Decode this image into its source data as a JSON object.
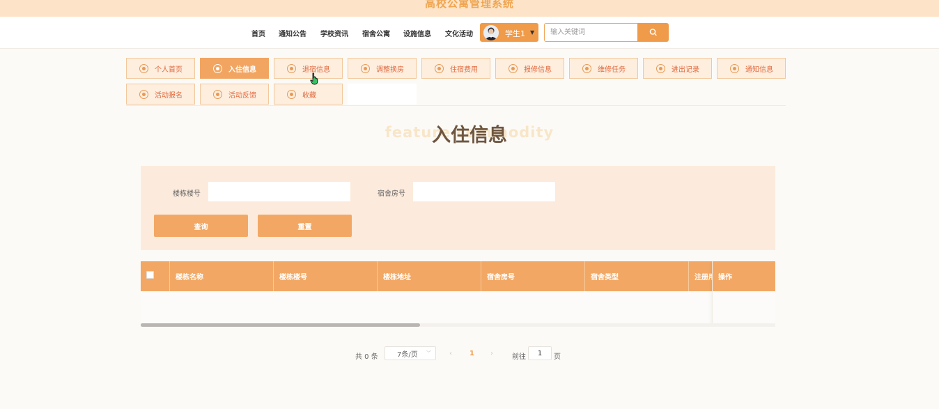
{
  "site": {
    "title": "高校公寓管理系统"
  },
  "nav": {
    "items": [
      "首页",
      "通知公告",
      "学校资讯",
      "宿舍公寓",
      "设施信息",
      "文化活动"
    ],
    "user_label": "学生1",
    "search_placeholder": "输入关键词"
  },
  "menu": {
    "items": [
      "个人首页",
      "入住信息",
      "退宿信息",
      "调整换房",
      "住宿费用",
      "报修信息",
      "维修任务",
      "进出记录",
      "通知信息",
      "活动报名",
      "活动反馈",
      "收藏"
    ],
    "active": "入住信息"
  },
  "page": {
    "heading": "入住信息",
    "heading_en": "feature commodity"
  },
  "filter": {
    "building_label": "楼栋楼号",
    "building_value": "",
    "room_label": "宿舍房号",
    "room_value": "",
    "query_button": "查询",
    "reset_button": "重置"
  },
  "table": {
    "columns": [
      "楼栋名称",
      "楼栋楼号",
      "楼栋地址",
      "宿舍房号",
      "宿舍类型",
      "注册用户",
      "操作"
    ],
    "rows": []
  },
  "pagination": {
    "total": "共 0 条",
    "page_size": "7条/页",
    "current_page": "1",
    "goto_label": "前往",
    "goto_value": "1",
    "goto_unit": "页"
  },
  "icons": {
    "user_caret": "caret-down-icon",
    "search": "search-icon",
    "menu": "circle-dot-icon",
    "cursor": "hand-pointer-icon"
  },
  "colors": {
    "accent": "#f09b4a",
    "menu_bg": "#fdeede",
    "panel_bg": "#fcebdc",
    "header_bg": "#fde4c8"
  }
}
